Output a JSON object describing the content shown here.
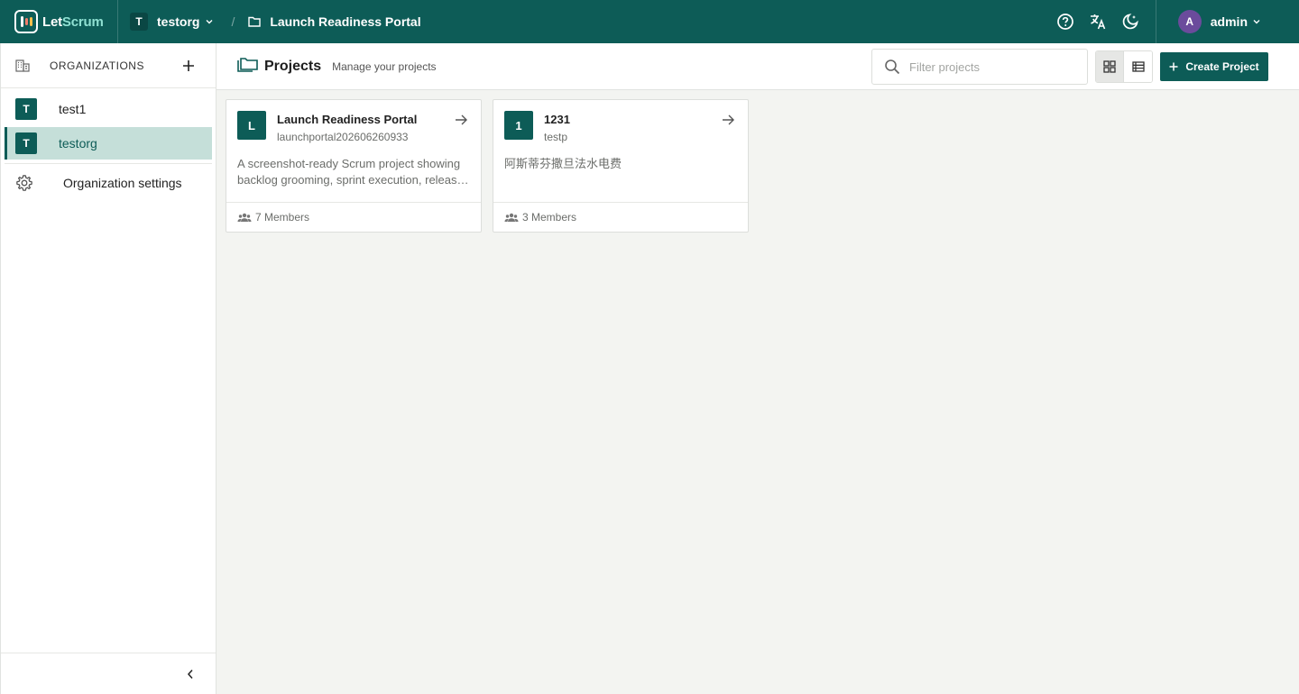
{
  "colors": {
    "primary": "#0d5c57",
    "active_bg": "#c5dfd9",
    "avatar_purple": "#6b4b9c"
  },
  "topbar": {
    "brand_let": "Let",
    "brand_scrum": "Scrum",
    "org_initial": "T",
    "org_name": "testorg",
    "separator": "/",
    "project_name": "Launch Readiness Portal",
    "icons": [
      "help-icon",
      "translate-icon",
      "dark-mode-icon"
    ],
    "user_initial": "A",
    "user_name": "admin"
  },
  "sidebar": {
    "title": "ORGANIZATIONS",
    "orgs": [
      {
        "initial": "T",
        "name": "test1",
        "active": false
      },
      {
        "initial": "T",
        "name": "testorg",
        "active": true
      }
    ],
    "settings_label": "Organization settings"
  },
  "header": {
    "title": "Projects",
    "subtitle": "Manage your projects",
    "search_placeholder": "Filter projects",
    "view_mode": "grid",
    "create_label": "Create Project"
  },
  "projects": [
    {
      "initial": "L",
      "name": "Launch Readiness Portal",
      "key": "launchportal202606260933",
      "description": "A screenshot-ready Scrum project showing backlog grooming, sprint execution, release readiness and team collaboration.",
      "members": "7 Members"
    },
    {
      "initial": "1",
      "name": "1231",
      "key": "testp",
      "description": "阿斯蒂芬撒旦法水电费",
      "members": "3 Members"
    }
  ]
}
